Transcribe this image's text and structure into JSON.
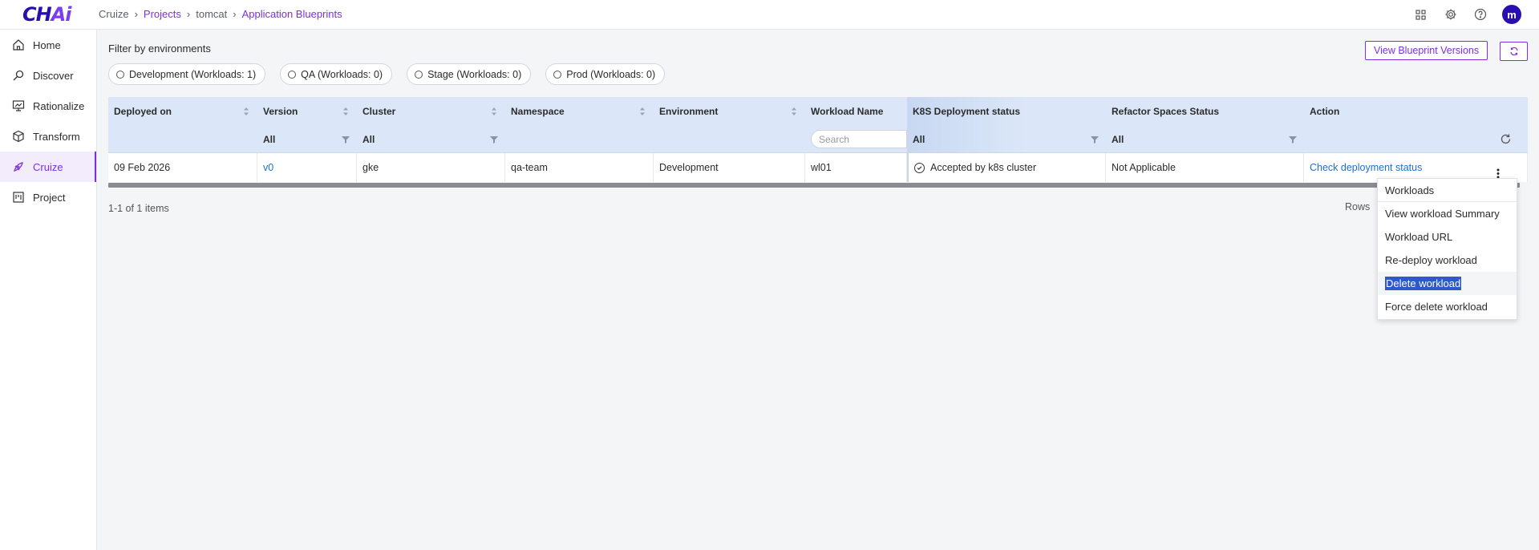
{
  "logo": {
    "main": "CH",
    "ai": "Ai"
  },
  "breadcrumb": [
    {
      "label": "Cruize",
      "link": false
    },
    {
      "label": "Projects",
      "link": true
    },
    {
      "label": "tomcat",
      "link": false
    },
    {
      "label": "Application Blueprints",
      "link": true
    }
  ],
  "header": {
    "icons": [
      "apps-grid-icon",
      "settings-gear-icon",
      "help-circle-icon"
    ],
    "avatar_initial": "m"
  },
  "sidebar": {
    "items": [
      {
        "label": "Home",
        "icon": "home-icon",
        "active": false
      },
      {
        "label": "Discover",
        "icon": "discover-icon",
        "active": false
      },
      {
        "label": "Rationalize",
        "icon": "rationalize-icon",
        "active": false
      },
      {
        "label": "Transform",
        "icon": "cube-icon",
        "active": false
      },
      {
        "label": "Cruize",
        "icon": "cruize-icon",
        "active": true
      },
      {
        "label": "Project",
        "icon": "project-icon",
        "active": false
      }
    ]
  },
  "filters": {
    "title": "Filter by environments",
    "chips": [
      "Development (Workloads: 1)",
      "QA (Workloads: 0)",
      "Stage (Workloads: 0)",
      "Prod (Workloads: 0)"
    ]
  },
  "toolbar": {
    "view_versions_label": "View Blueprint Versions"
  },
  "table": {
    "columns": [
      {
        "label": "Deployed on",
        "filter": ""
      },
      {
        "label": "Version",
        "filter": "All"
      },
      {
        "label": "Cluster",
        "filter": "All"
      },
      {
        "label": "Namespace",
        "filter": ""
      },
      {
        "label": "Environment",
        "filter": ""
      },
      {
        "label": "Workload Name",
        "filter": ""
      },
      {
        "label": "K8S Deployment status",
        "filter": "All"
      },
      {
        "label": "Refactor Spaces Status",
        "filter": "All"
      },
      {
        "label": "Action",
        "filter": ""
      }
    ],
    "search_placeholder": "Search",
    "rows": [
      {
        "deployed_on": "09 Feb 2026",
        "version": "v0",
        "cluster": "gke",
        "namespace": "qa-team",
        "environment": "Development",
        "workload_name": "wl01",
        "k8s_status": "Accepted by k8s cluster",
        "refactor_status": "Not Applicable",
        "action": "Check deployment status"
      }
    ]
  },
  "pager": {
    "summary": "1-1 of 1 items",
    "rows_label": "Rows"
  },
  "menu": {
    "title": "Workloads",
    "items": [
      "View workload Summary",
      "Workload URL",
      "Re-deploy workload",
      "Delete workload",
      "Force delete workload"
    ]
  }
}
